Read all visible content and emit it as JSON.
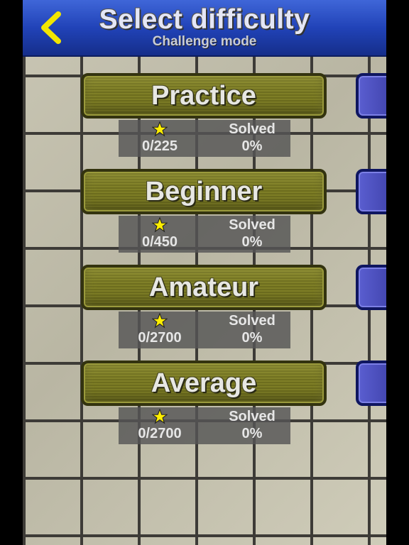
{
  "header": {
    "title": "Select difficulty",
    "subtitle": "Challenge mode",
    "back_icon": "chevron-left-icon"
  },
  "levels": [
    {
      "label": "Practice",
      "stars": "0/225",
      "solved_label": "Solved",
      "solved": "0%"
    },
    {
      "label": "Beginner",
      "stars": "0/450",
      "solved_label": "Solved",
      "solved": "0%"
    },
    {
      "label": "Amateur",
      "stars": "0/2700",
      "solved_label": "Solved",
      "solved": "0%"
    },
    {
      "label": "Average",
      "stars": "0/2700",
      "solved_label": "Solved",
      "solved": "0%"
    }
  ],
  "colors": {
    "header_blue": "#2143b8",
    "back_yellow": "#f2e600",
    "level_olive": "#7e7e26",
    "side_button_purple": "#4a4dbd",
    "star_yellow": "#ffee00"
  }
}
